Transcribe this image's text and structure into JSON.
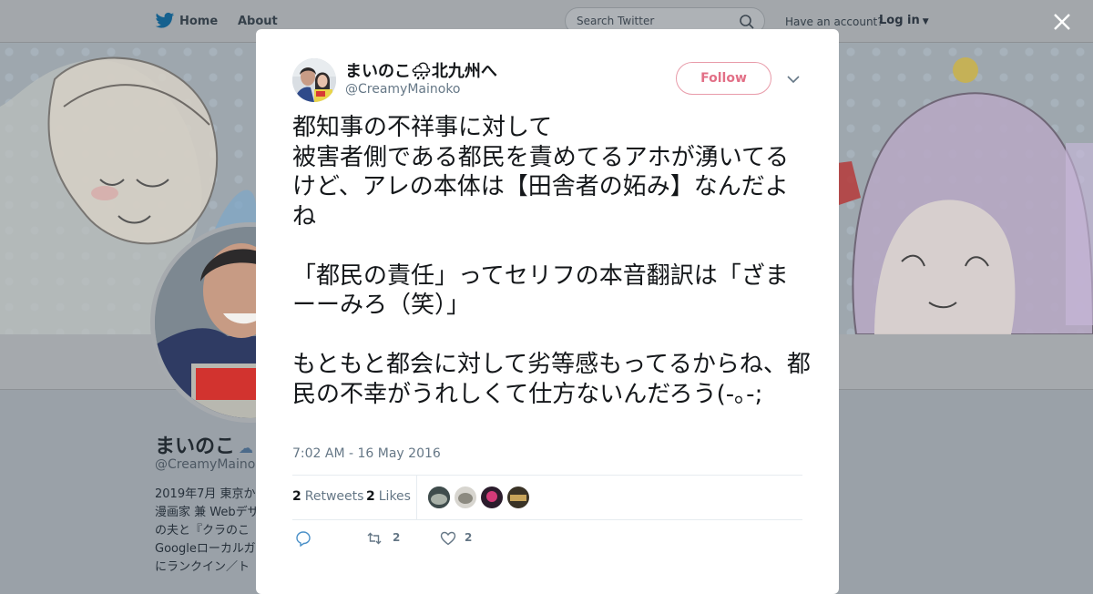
{
  "topbar": {
    "nav": [
      "Home",
      "About"
    ],
    "search_placeholder": "Search Twitter",
    "account_prompt": "Have an account?",
    "login_label": "Log in"
  },
  "profile": {
    "name": "まいのこ",
    "handle": "@CreamyMainoko",
    "bio_lines": [
      "2019年7月 東京か",
      "漫画家 兼 Webデザ",
      "の夫と『クラのこ",
      "Googleローカルガ",
      "にランクイン／ト"
    ]
  },
  "tweet": {
    "author_name": "まいのこ🌧北九州へ",
    "author_handle": "@CreamyMainoko",
    "follow_label": "Follow",
    "paragraphs": [
      "都知事の不祥事に対して\n被害者側である都民を責めてるアホが湧いてるけど、アレの本体は【田舎者の妬み】なんだよね",
      "「都民の責任」ってセリフの本音翻訳は「ざまーーみろ（笑）」",
      "もともと都会に対して劣等感もってるからね、都民の不幸がうれしくて仕方ないんだろう(-｡-;"
    ],
    "timestamp": "7:02 AM - 16 May 2016",
    "retweets_count": "2",
    "retweets_label": "Retweets",
    "likes_count": "2",
    "likes_label": "Likes",
    "action_retweet_count": "2",
    "action_like_count": "2"
  },
  "colors": {
    "accent": "#e26f86",
    "twitter_blue": "#1da1f2",
    "secondary_text": "#657786"
  }
}
